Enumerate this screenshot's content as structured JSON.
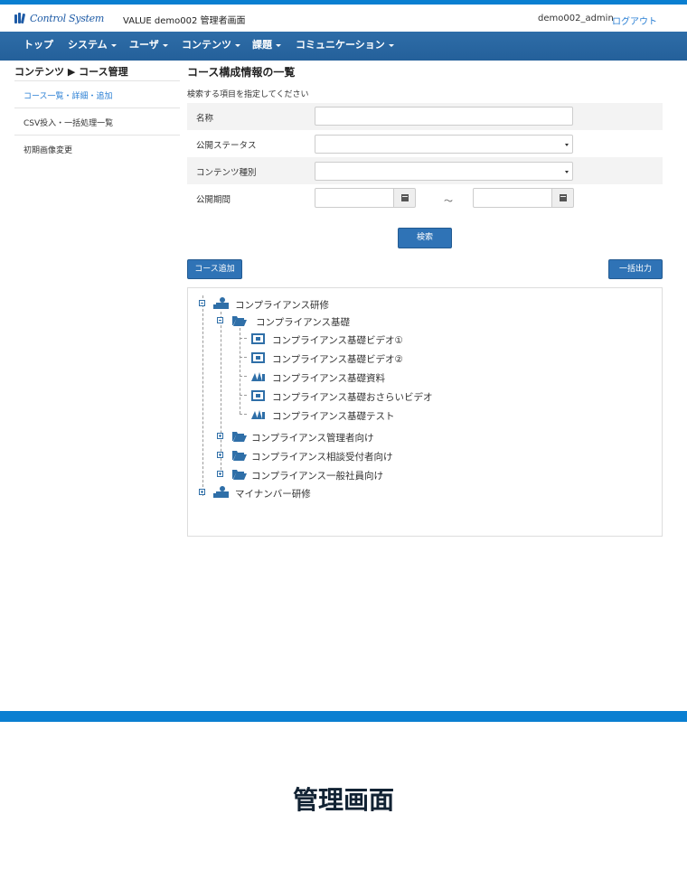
{
  "header": {
    "logo_text": "Control System",
    "app_title": "VALUE demo002 管理者画面",
    "user_name": "demo002_admin",
    "logout_label": "ログアウト"
  },
  "nav": {
    "items": [
      {
        "label": "トップ",
        "dropdown": false
      },
      {
        "label": "システム",
        "dropdown": true
      },
      {
        "label": "ユーザ",
        "dropdown": true
      },
      {
        "label": "コンテンツ",
        "dropdown": true
      },
      {
        "label": "課題",
        "dropdown": true
      },
      {
        "label": "コミュニケーション",
        "dropdown": true
      }
    ]
  },
  "sidebar": {
    "breadcrumb": "コンテンツ ▶ コース管理",
    "items": [
      {
        "label": "コース一覧・詳細・追加",
        "active": true
      },
      {
        "label": "CSV投入・一括処理一覧",
        "active": false
      },
      {
        "label": "初期画像変更",
        "active": false
      }
    ]
  },
  "main": {
    "title": "コース構成情報の一覧",
    "instruction": "検索する項目を指定してください",
    "form": {
      "name_label": "名称",
      "name_value": "",
      "status_label": "公開ステータス",
      "status_value": "",
      "type_label": "コンテンツ種別",
      "type_value": "",
      "period_label": "公開期間",
      "period_from": "",
      "period_to": "",
      "period_separator": "～"
    },
    "search_button": "検索",
    "add_course_button": "コース追加",
    "export_button": "一括出力",
    "tree": {
      "course1": "コンプライアンス研修",
      "folder_basic": "コンプライアンス基礎",
      "leaves": [
        {
          "label": "コンプライアンス基礎ビデオ①",
          "icon": "video-icon"
        },
        {
          "label": "コンプライアンス基礎ビデオ②",
          "icon": "video-icon"
        },
        {
          "label": "コンプライアンス基礎資料",
          "icon": "book-icon"
        },
        {
          "label": "コンプライアンス基礎おさらいビデオ",
          "icon": "video-icon"
        },
        {
          "label": "コンプライアンス基礎テスト",
          "icon": "book-icon"
        }
      ],
      "folders": [
        "コンプライアンス管理者向け",
        "コンプライアンス相談受付者向け",
        "コンプライアンス一般社員向け"
      ],
      "course2": "マイナンバー研修"
    }
  },
  "footer": {
    "caption": "管理画面"
  },
  "colors": {
    "accent_blue": "#0a7fd1",
    "nav_blue": "#2e6da8",
    "button_blue": "#2f73b6",
    "link_blue": "#2a7fd4"
  }
}
